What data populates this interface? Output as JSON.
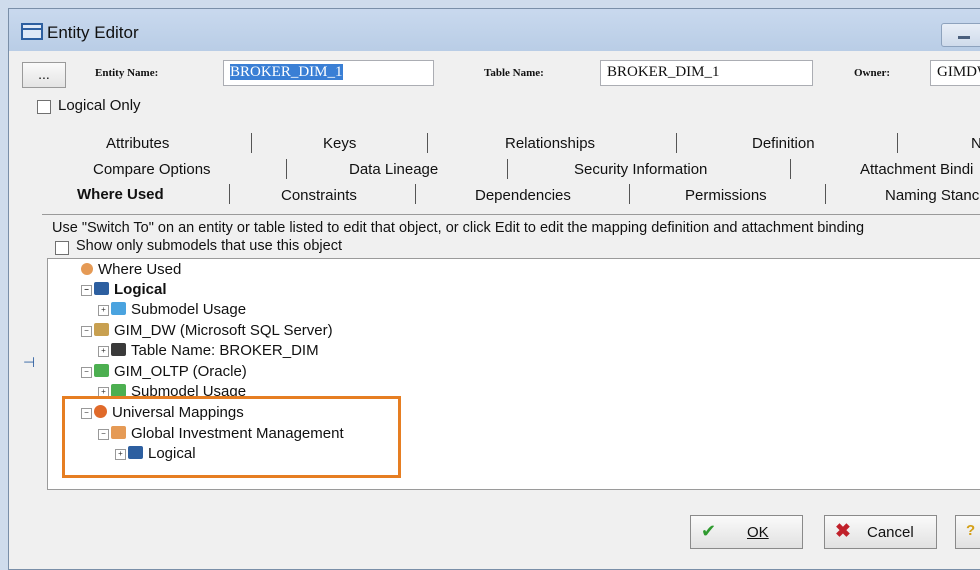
{
  "window": {
    "title": "Entity Editor"
  },
  "header": {
    "more_button_label": "...",
    "entity_name_label": "Entity Name:",
    "entity_name_value": "BROKER_DIM_1",
    "table_name_label": "Table Name:",
    "table_name_value": "BROKER_DIM_1",
    "owner_label": "Owner:",
    "owner_value": "GIMDW"
  },
  "logical_only_label": "Logical Only",
  "tabs": {
    "row1": [
      "Attributes",
      "Keys",
      "Relationships",
      "Definition",
      "N"
    ],
    "row2": [
      "Compare Options",
      "Data Lineage",
      "Security Information",
      "Attachment Bindi"
    ],
    "row3": [
      "Where Used",
      "Constraints",
      "Dependencies",
      "Permissions",
      "Naming Stanc"
    ],
    "active": "Where Used"
  },
  "where_used": {
    "info_text": "Use \"Switch To\" on an entity or table listed to edit that object, or click Edit to edit the mapping definition and attachment binding",
    "show_submodels_label": "Show only submodels that use this object",
    "tree": {
      "root": "Where Used",
      "logical": "Logical",
      "submodel_usage_1": "Submodel Usage",
      "gim_dw": "GIM_DW (Microsoft SQL Server)",
      "table_name": "Table Name: BROKER_DIM",
      "gim_oltp": "GIM_OLTP (Oracle)",
      "submodel_usage_2": "Submodel Usage",
      "universal_mappings": "Universal Mappings",
      "global_investment": "Global Investment Management",
      "logical_2": "Logical"
    }
  },
  "footer": {
    "ok_label": "OK",
    "cancel_label": "Cancel"
  },
  "colors": {
    "highlight_border": "#e67e22",
    "selection": "#3a7fd5",
    "titlebar": "#c9d9ee"
  }
}
